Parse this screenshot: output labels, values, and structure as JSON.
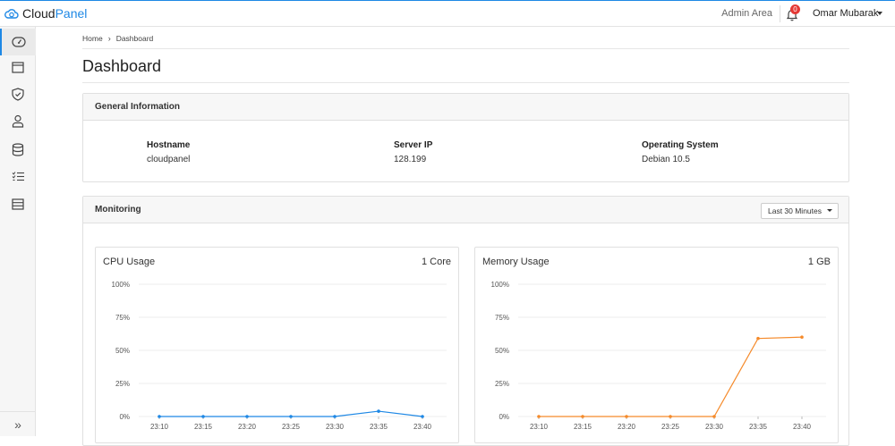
{
  "app": {
    "name_part1": "Cloud",
    "name_part2": "Panel"
  },
  "header": {
    "admin_area": "Admin Area",
    "notification_count": "0",
    "user_name": "Omar Mubarak"
  },
  "sidebar": {
    "items": [
      "dashboard-icon",
      "sites-icon",
      "security-icon",
      "users-icon",
      "databases-icon",
      "tasks-icon",
      "logs-icon"
    ],
    "expand_label": "»"
  },
  "breadcrumb": {
    "home": "Home",
    "separator": "›",
    "current": "Dashboard"
  },
  "page": {
    "title": "Dashboard"
  },
  "general": {
    "title": "General Information",
    "hostname_label": "Hostname",
    "hostname_value": "cloudpanel",
    "ip_label": "Server IP",
    "ip_value": "128.199",
    "os_label": "Operating System",
    "os_value": "Debian 10.5"
  },
  "monitoring": {
    "title": "Monitoring",
    "range_label": "Last 30 Minutes"
  },
  "colors": {
    "accent": "#1e88e5",
    "cpu": "#1e88e5",
    "memory": "#f58a2a",
    "badge": "#e53935"
  },
  "chart_data": [
    {
      "type": "line",
      "title": "CPU Usage",
      "unit_label": "1 Core",
      "x": [
        "23:10",
        "23:15",
        "23:20",
        "23:25",
        "23:30",
        "23:35",
        "23:40"
      ],
      "values": [
        0,
        0,
        0,
        0,
        0,
        4,
        0
      ],
      "yticks": [
        "100%",
        "75%",
        "50%",
        "25%",
        "0%"
      ],
      "ylim": [
        0,
        100
      ],
      "color": "#1e88e5"
    },
    {
      "type": "line",
      "title": "Memory Usage",
      "unit_label": "1 GB",
      "x": [
        "23:10",
        "23:15",
        "23:20",
        "23:25",
        "23:30",
        "23:35",
        "23:40"
      ],
      "values": [
        0,
        0,
        0,
        0,
        0,
        59,
        60
      ],
      "yticks": [
        "100%",
        "75%",
        "50%",
        "25%",
        "0%"
      ],
      "ylim": [
        0,
        100
      ],
      "color": "#f58a2a"
    }
  ]
}
